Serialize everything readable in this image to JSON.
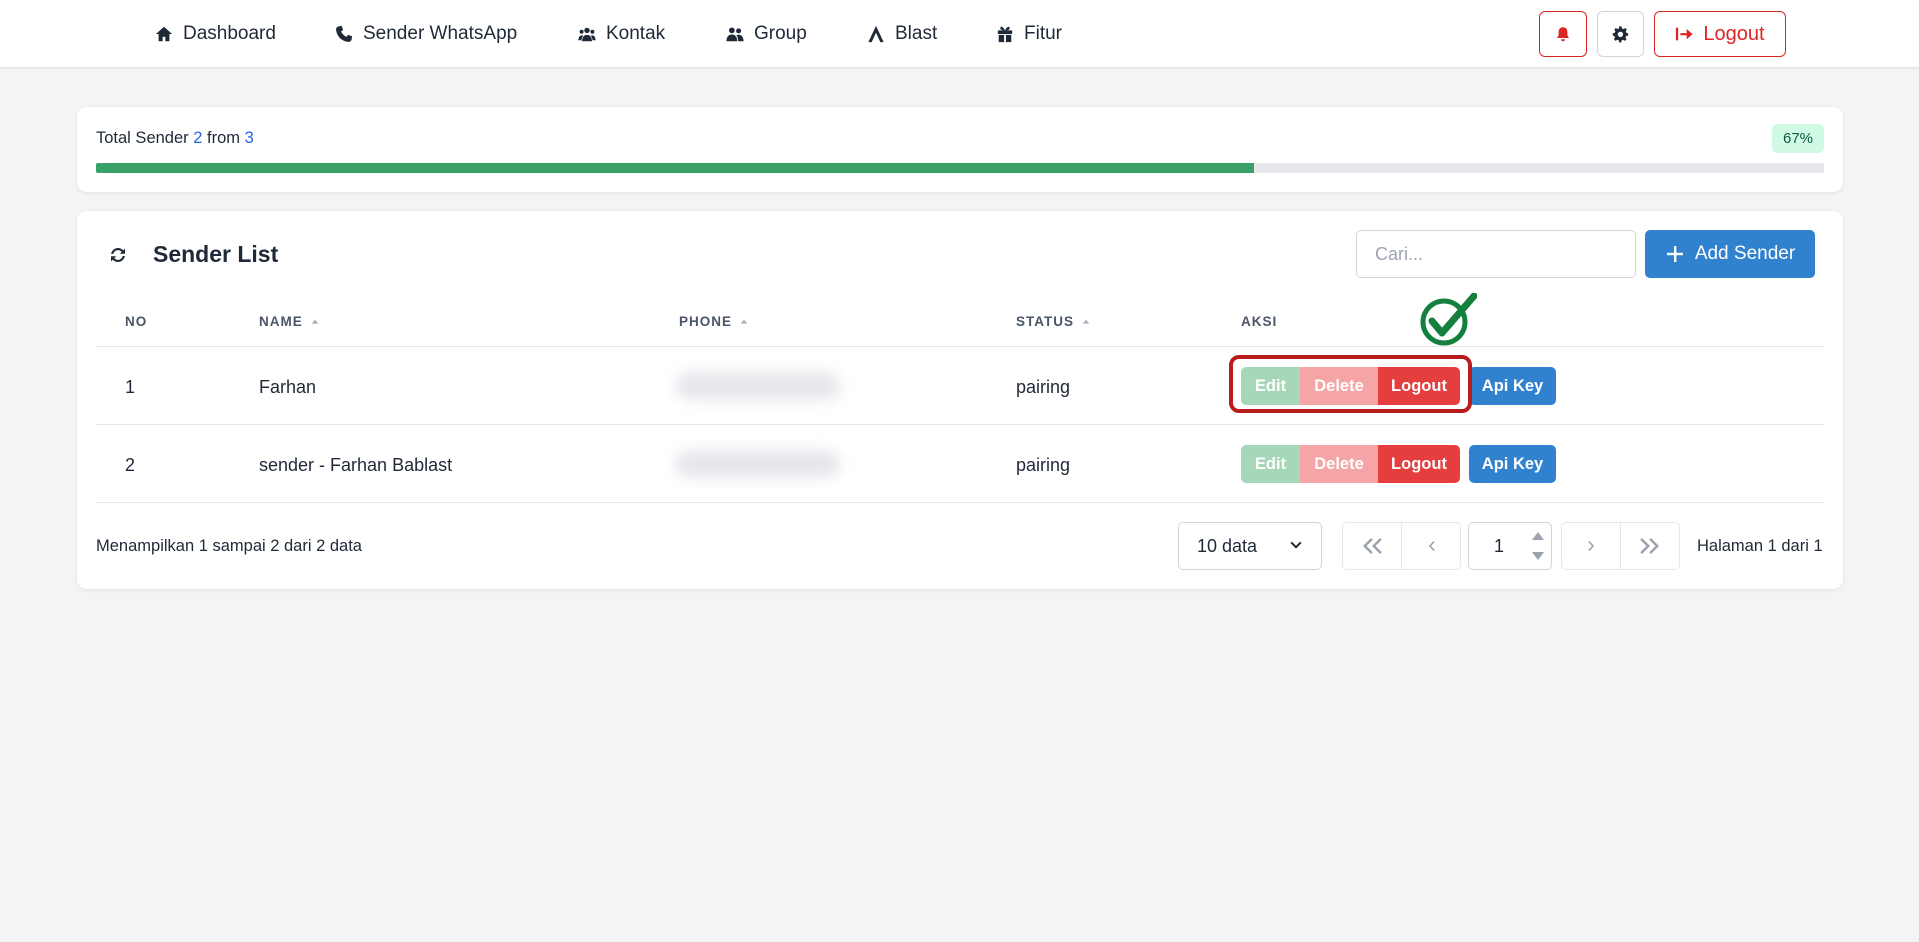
{
  "nav": {
    "items": [
      {
        "label": "Dashboard",
        "icon": "home-icon"
      },
      {
        "label": "Sender WhatsApp",
        "icon": "phone-icon"
      },
      {
        "label": "Kontak",
        "icon": "users-icon"
      },
      {
        "label": "Group",
        "icon": "user-group-icon"
      },
      {
        "label": "Blast",
        "icon": "blast-icon"
      },
      {
        "label": "Fitur",
        "icon": "gift-icon"
      }
    ],
    "logout_label": "Logout"
  },
  "summary": {
    "label": "Total Sender",
    "used": "2",
    "from_label": "from",
    "total": "3",
    "percent_label": "67%",
    "progress": 0.67
  },
  "sender_list": {
    "title": "Sender List",
    "search_placeholder": "Cari...",
    "add_label": "Add Sender",
    "columns": {
      "no": "NO",
      "name": "NAME",
      "phone": "PHONE",
      "status": "STATUS",
      "aksi": "AKSI"
    },
    "actions": {
      "edit": "Edit",
      "delete": "Delete",
      "logout": "Logout",
      "api_key": "Api Key"
    },
    "rows": [
      {
        "no": "1",
        "name": "Farhan",
        "status": "pairing"
      },
      {
        "no": "2",
        "name": "sender - Farhan Bablast",
        "status": "pairing"
      }
    ]
  },
  "footer": {
    "info": "Menampilkan 1 sampai 2 dari 2 data",
    "per_page": "10 data",
    "page_value": "1",
    "page_info": "Halaman 1 dari 1"
  },
  "colors": {
    "primary": "#3182ce",
    "danger": "#e53e3e",
    "success": "#38a169",
    "highlight": "#b91c1c"
  }
}
